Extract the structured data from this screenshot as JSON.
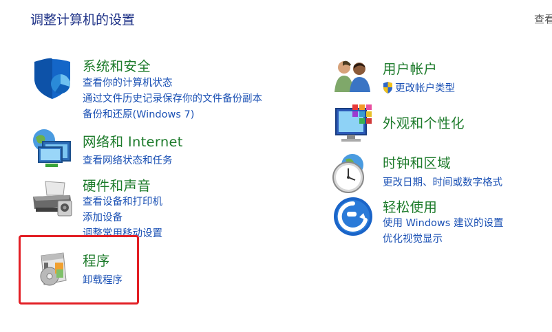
{
  "page": {
    "title": "调整计算机的设置",
    "view_by": "查看"
  },
  "categories": {
    "system_security": {
      "title": "系统和安全",
      "links": [
        "查看你的计算机状态",
        "通过文件历史记录保存你的文件备份副本",
        "备份和还原(Windows 7)"
      ]
    },
    "network": {
      "title": "网络和 Internet",
      "links": [
        "查看网络状态和任务"
      ]
    },
    "hardware": {
      "title": "硬件和声音",
      "links": [
        "查看设备和打印机",
        "添加设备",
        "调整常用移动设置"
      ]
    },
    "programs": {
      "title": "程序",
      "links": [
        "卸载程序"
      ]
    },
    "user_accounts": {
      "title": "用户帐户",
      "links": [
        "更改帐户类型"
      ]
    },
    "appearance": {
      "title": "外观和个性化",
      "links": []
    },
    "clock_region": {
      "title": "时钟和区域",
      "links": [
        "更改日期、时间或数字格式"
      ]
    },
    "ease_of_access": {
      "title": "轻松使用",
      "links": [
        "使用 Windows 建议的设置",
        "优化视觉显示"
      ]
    }
  },
  "colors": {
    "title_blue": "#1e3287",
    "category_green": "#1d7b2b",
    "link_blue": "#1a50b4",
    "highlight_red": "#e21e24"
  }
}
